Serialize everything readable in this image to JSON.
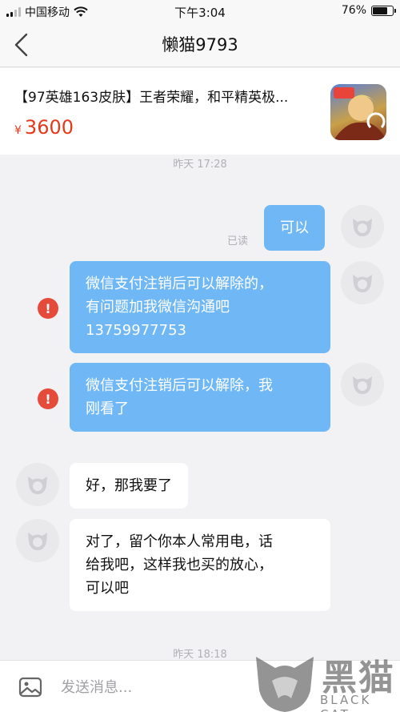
{
  "status_bar": {
    "carrier": "中国移动",
    "time": "下午3:04",
    "battery": "76%",
    "battery_level": 0.76
  },
  "nav": {
    "title": "懒猫9793"
  },
  "product": {
    "title": "【97英雄163皮肤】王者荣耀，和平精英极...",
    "price_symbol": "¥",
    "price": "3600"
  },
  "chat": {
    "timestamp_1": "昨天 17:28",
    "timestamp_2": "昨天 18:18",
    "read_label": "已读",
    "messages": [
      {
        "direction": "out",
        "lines": [
          "可以"
        ],
        "status": "read"
      },
      {
        "direction": "out",
        "lines": [
          "微信支付注销后可以解除的，",
          "有问题加我微信沟通吧",
          "13759977753"
        ],
        "status": "failed"
      },
      {
        "direction": "out",
        "lines": [
          "微信支付注销后可以解除，我",
          "刚看了"
        ],
        "status": "failed"
      },
      {
        "direction": "in",
        "lines": [
          "好，那我要了"
        ]
      },
      {
        "direction": "in",
        "lines": [
          "对了，留个你本人常用电，话",
          "给我吧，这样我也买的放心，",
          "可以吧"
        ]
      }
    ]
  },
  "input": {
    "placeholder": "发送消息..."
  },
  "watermark": {
    "text_big": "黑猫",
    "text_small": "BLACK CAT"
  },
  "colors": {
    "outgoing_bubble": "#70b8f5",
    "price": "#e4391b",
    "error": "#e54b3a"
  },
  "icons": [
    "signal-icon",
    "wifi-icon",
    "battery-icon",
    "back-arrow-icon",
    "avatar-placeholder-icon",
    "error-icon",
    "image-icon",
    "black-cat-logo-icon"
  ]
}
